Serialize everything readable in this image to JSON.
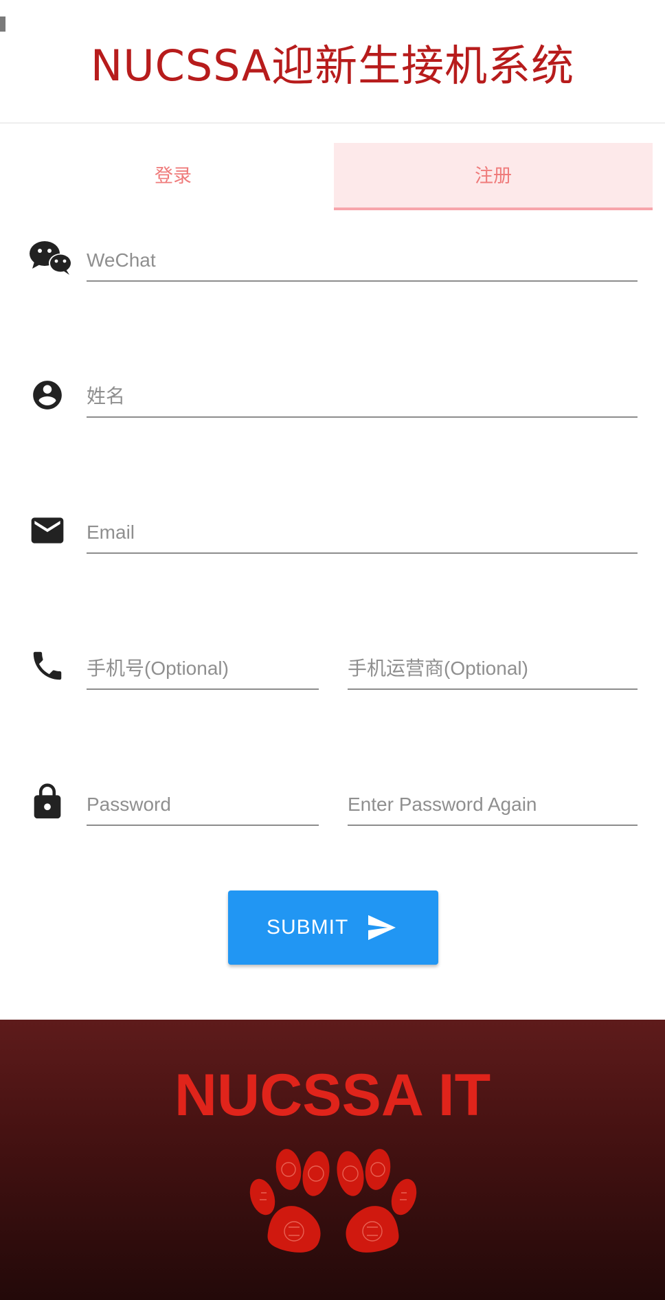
{
  "app": {
    "title": "NUCSSA迎新生接机系统"
  },
  "tabs": [
    {
      "label": "登录",
      "active": false
    },
    {
      "label": "注册",
      "active": true
    }
  ],
  "form": {
    "wechat": {
      "placeholder": "WeChat",
      "value": "",
      "icon": "wechat-icon"
    },
    "name": {
      "placeholder": "姓名",
      "value": "",
      "icon": "account-circle-icon"
    },
    "email": {
      "placeholder": "Email",
      "value": "",
      "icon": "mail-icon"
    },
    "phone": {
      "placeholder": "手机号(Optional)",
      "value": "",
      "icon": "phone-icon"
    },
    "carrier": {
      "placeholder": "手机运营商(Optional)",
      "value": ""
    },
    "password": {
      "placeholder": "Password",
      "value": "",
      "icon": "lock-icon"
    },
    "password_again": {
      "placeholder": "Enter Password Again",
      "value": ""
    },
    "submit_label": "SUBMIT"
  },
  "footer": {
    "title": "NUCSSA IT",
    "logo": "paw-logo"
  },
  "colors": {
    "title": "#b71c1c",
    "tab_text": "#ef7b7b",
    "tab_active_bg": "#fde9ea",
    "tab_active_border": "#f7a5ab",
    "submit_bg": "#2196f3",
    "footer_title": "#e0241b",
    "paw": "#d0190f"
  }
}
